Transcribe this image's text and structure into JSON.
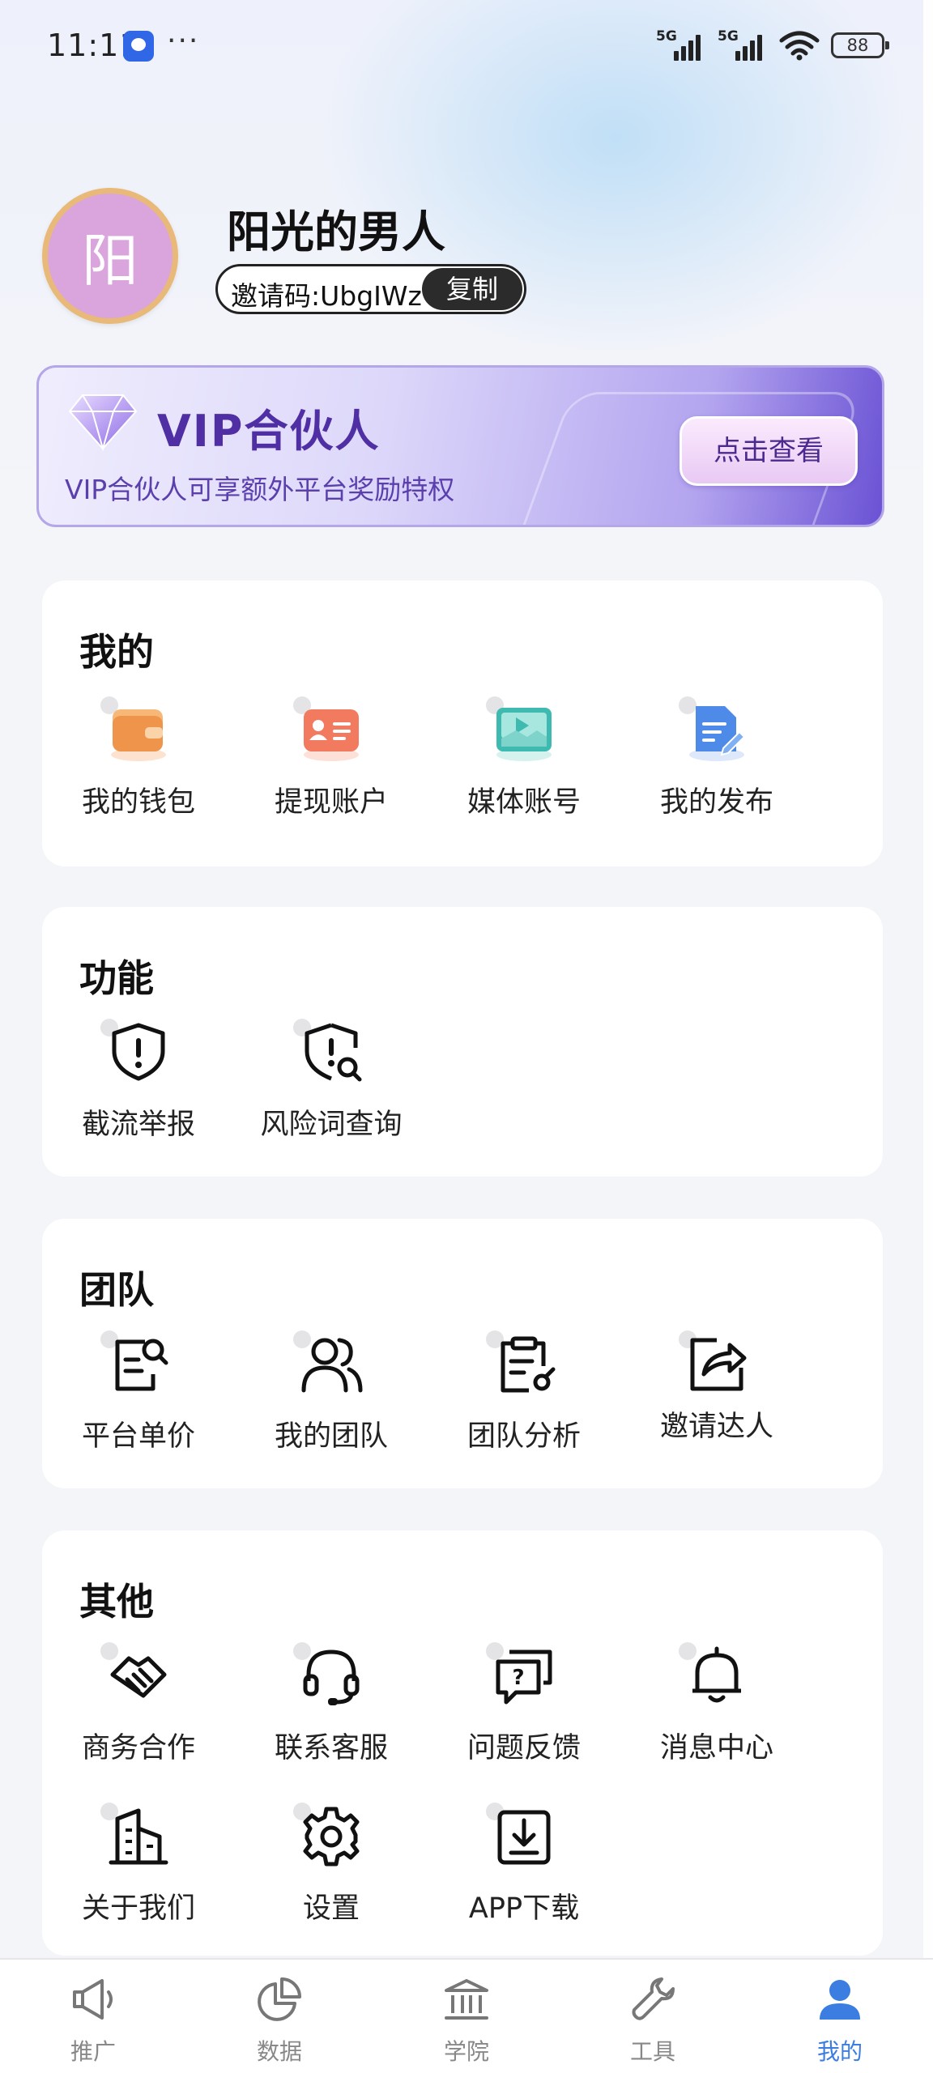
{
  "status_bar": {
    "time": "11:11",
    "signal_1": "5G",
    "signal_2": "5G",
    "battery": "88"
  },
  "profile": {
    "avatar_char": "阳",
    "name": "阳光的男人",
    "invite_code": "邀请码:UbgIWz",
    "copy_label": "复制"
  },
  "vip": {
    "title": "VIP合伙人",
    "description": "VIP合伙人可享额外平台奖励特权",
    "button_label": "点击查看",
    "accent": "#6a52d4"
  },
  "sections": {
    "mine": {
      "title": "我的",
      "items": [
        {
          "label": "我的钱包",
          "icon": "wallet-icon"
        },
        {
          "label": "提现账户",
          "icon": "id-card-icon"
        },
        {
          "label": "媒体账号",
          "icon": "media-icon"
        },
        {
          "label": "我的发布",
          "icon": "document-edit-icon"
        }
      ]
    },
    "features": {
      "title": "功能",
      "items": [
        {
          "label": "截流举报",
          "icon": "shield-alert-icon"
        },
        {
          "label": "风险词查询",
          "icon": "shield-search-icon"
        }
      ]
    },
    "team": {
      "title": "团队",
      "items": [
        {
          "label": "平台单价",
          "icon": "doc-search-icon"
        },
        {
          "label": "我的团队",
          "icon": "team-icon"
        },
        {
          "label": "团队分析",
          "icon": "clipboard-analysis-icon"
        },
        {
          "label": "邀请达人",
          "icon": "share-icon"
        }
      ]
    },
    "other": {
      "title": "其他",
      "items": [
        {
          "label": "商务合作",
          "icon": "handshake-icon"
        },
        {
          "label": "联系客服",
          "icon": "headset-icon"
        },
        {
          "label": "问题反馈",
          "icon": "feedback-icon"
        },
        {
          "label": "消息中心",
          "icon": "bell-icon"
        },
        {
          "label": "关于我们",
          "icon": "building-icon"
        },
        {
          "label": "设置",
          "icon": "gear-icon"
        },
        {
          "label": "APP下载",
          "icon": "download-icon"
        }
      ]
    }
  },
  "bottom_nav": {
    "items": [
      {
        "label": "推广",
        "icon": "megaphone-icon"
      },
      {
        "label": "数据",
        "icon": "pie-chart-icon"
      },
      {
        "label": "学院",
        "icon": "academy-icon"
      },
      {
        "label": "工具",
        "icon": "wrench-icon"
      },
      {
        "label": "我的",
        "icon": "user-icon"
      }
    ],
    "active": "我的",
    "active_color": "#3b7de0"
  }
}
